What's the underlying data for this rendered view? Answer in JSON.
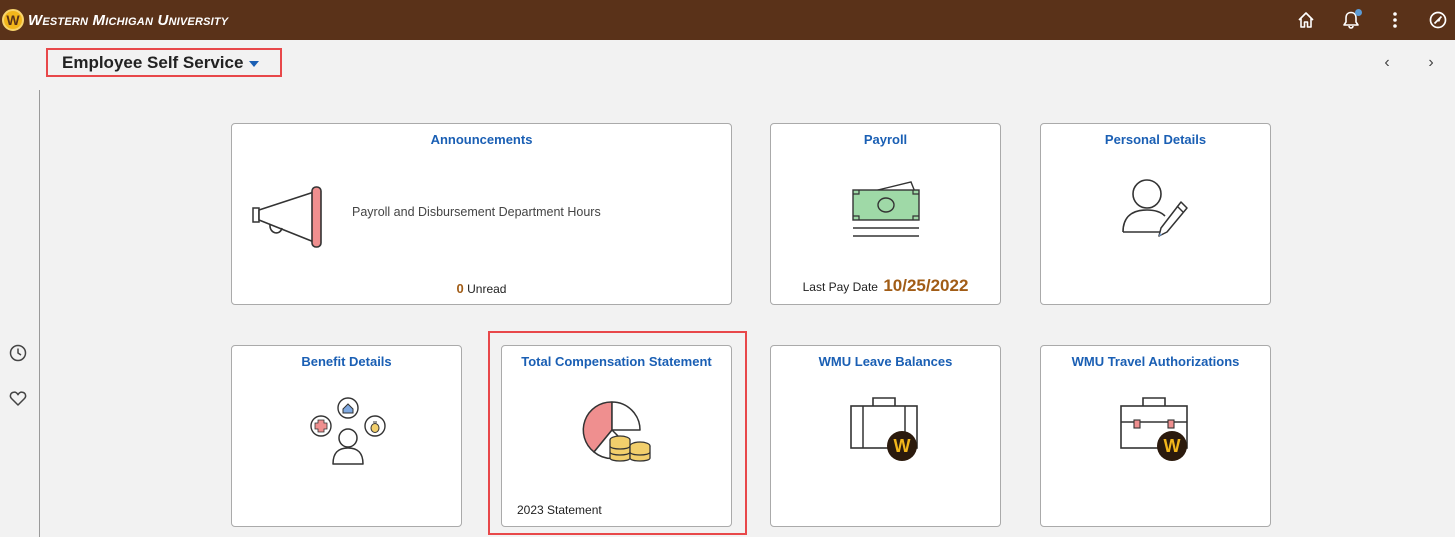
{
  "topbar": {
    "logo_letter": "W",
    "logo_text": "Western Michigan University",
    "icons": [
      "home-icon",
      "notification-icon",
      "actions-menu-icon",
      "navbar-icon"
    ]
  },
  "header": {
    "home_selector_label": "Employee Self Service",
    "prev_arrow": "‹",
    "next_arrow": "›"
  },
  "sidebar": {
    "icons": [
      "recent-places-icon",
      "favorites-icon"
    ]
  },
  "tiles": {
    "announcements": {
      "title": "Announcements",
      "message": "Payroll and Disbursement Department Hours",
      "unread_count": "0",
      "unread_label": "Unread"
    },
    "payroll": {
      "title": "Payroll",
      "footer_label": "Last Pay Date",
      "footer_value": "10/25/2022"
    },
    "personal_details": {
      "title": "Personal Details"
    },
    "benefit_details": {
      "title": "Benefit Details"
    },
    "total_compensation": {
      "title": "Total Compensation Statement",
      "footer": "2023 Statement"
    },
    "leave_balances": {
      "title": "WMU Leave Balances",
      "badge_letter": "W"
    },
    "travel_authorizations": {
      "title": "WMU Travel Authorizations",
      "badge_letter": "W"
    }
  },
  "colors": {
    "topbar": "#5a3219",
    "accent_gold": "#f2b61b",
    "link_blue": "#1a5fb4",
    "highlight_red": "#e8484a",
    "pay_date": "#a15c16"
  }
}
